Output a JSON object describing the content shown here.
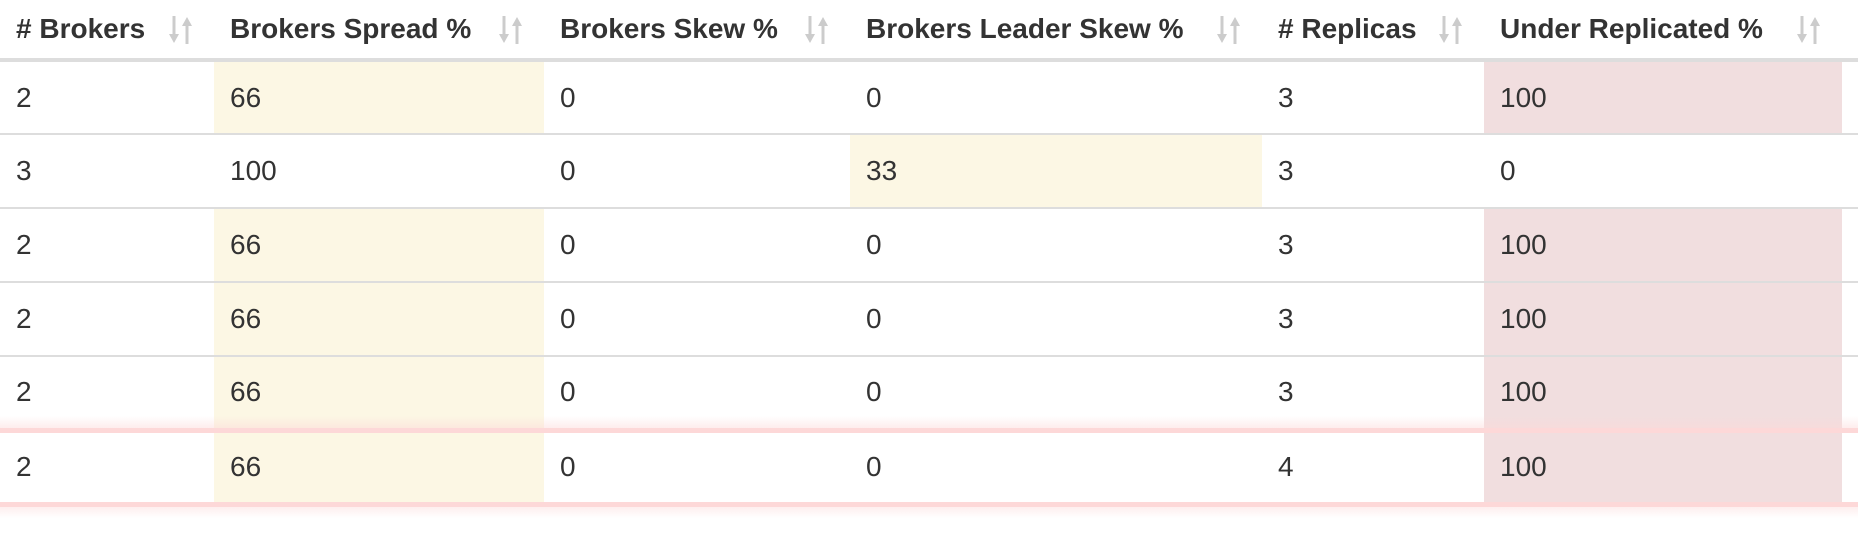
{
  "table": {
    "headers": [
      {
        "label": "# Brokers"
      },
      {
        "label": "Brokers Spread %"
      },
      {
        "label": "Brokers Skew %"
      },
      {
        "label": "Brokers Leader Skew %"
      },
      {
        "label": "# Replicas"
      },
      {
        "label": "Under Replicated %"
      }
    ],
    "rows": [
      {
        "cells": [
          "2",
          "66",
          "0",
          "0",
          "3",
          "100"
        ],
        "status": [
          "",
          "warn",
          "",
          "",
          "",
          "danger"
        ]
      },
      {
        "cells": [
          "3",
          "100",
          "0",
          "33",
          "3",
          "0"
        ],
        "status": [
          "",
          "",
          "",
          "warn",
          "",
          ""
        ]
      },
      {
        "cells": [
          "2",
          "66",
          "0",
          "0",
          "3",
          "100"
        ],
        "status": [
          "",
          "warn",
          "",
          "",
          "",
          "danger"
        ]
      },
      {
        "cells": [
          "2",
          "66",
          "0",
          "0",
          "3",
          "100"
        ],
        "status": [
          "",
          "warn",
          "",
          "",
          "",
          "danger"
        ]
      },
      {
        "cells": [
          "2",
          "66",
          "0",
          "0",
          "3",
          "100"
        ],
        "status": [
          "",
          "warn",
          "",
          "",
          "",
          "danger"
        ]
      },
      {
        "cells": [
          "2",
          "66",
          "0",
          "0",
          "4",
          "100"
        ],
        "status": [
          "",
          "warn",
          "",
          "",
          "",
          "danger"
        ],
        "highlighted": true
      }
    ]
  },
  "icons": {
    "sort": "sort-icon"
  },
  "colors": {
    "warn": "#fcf7e4",
    "danger": "#f1dedf",
    "highlight": "#fdd8d8",
    "sort_icon": "#cccccc"
  }
}
